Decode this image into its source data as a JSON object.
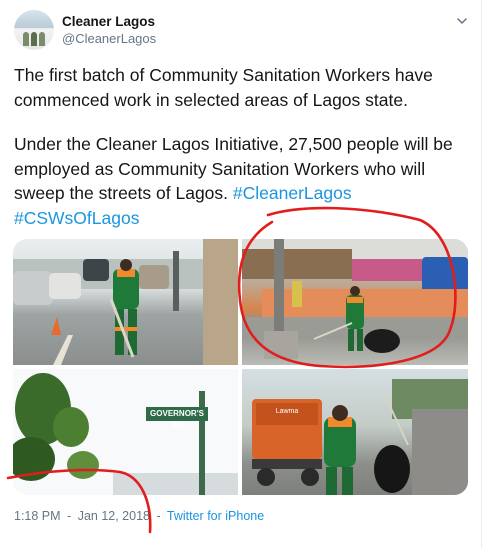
{
  "tweet": {
    "display_name": "Cleaner Lagos",
    "handle": "@CleanerLagos",
    "paragraph1": "The first batch of Community Sanitation Workers have commenced work in selected areas of Lagos state.",
    "paragraph2_text": "Under the Cleaner Lagos Initiative, 27,500 people will be employed as Community Sanitation Workers who will sweep the streets of Lagos. ",
    "hashtag1": "#CleanerLagos",
    "hashtag2": "#CSWsOfLagos",
    "time": "1:18 PM",
    "date": "Jan 12, 2018",
    "separator": "-",
    "source": "Twitter for iPhone"
  },
  "media": {
    "street_sign": "GOVERNOR'S RD",
    "truck_text": "Lawma"
  },
  "colors": {
    "link": "#1b95e0",
    "meta": "#657786",
    "annotation": "#e11d1d"
  }
}
